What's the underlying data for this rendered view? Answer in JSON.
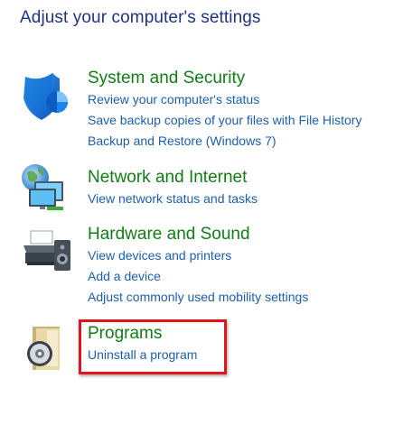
{
  "page": {
    "title": "Adjust your computer's settings"
  },
  "colors": {
    "title": "#1e3287",
    "category_title": "#0f7f12",
    "link": "#1a5fb4",
    "highlight": "#e0141a"
  },
  "categories": [
    {
      "title": "System and Security",
      "icon": "shield-icon",
      "links": [
        "Review your computer's status",
        "Save backup copies of your files with File History",
        "Backup and Restore (Windows 7)"
      ]
    },
    {
      "title": "Network and Internet",
      "icon": "network-globe-icon",
      "links": [
        "View network status and tasks"
      ]
    },
    {
      "title": "Hardware and Sound",
      "icon": "printer-speaker-icon",
      "links": [
        "View devices and printers",
        "Add a device",
        "Adjust commonly used mobility settings"
      ]
    },
    {
      "title": "Programs",
      "icon": "programs-disc-icon",
      "highlighted": true,
      "links": [
        "Uninstall a program"
      ]
    }
  ]
}
